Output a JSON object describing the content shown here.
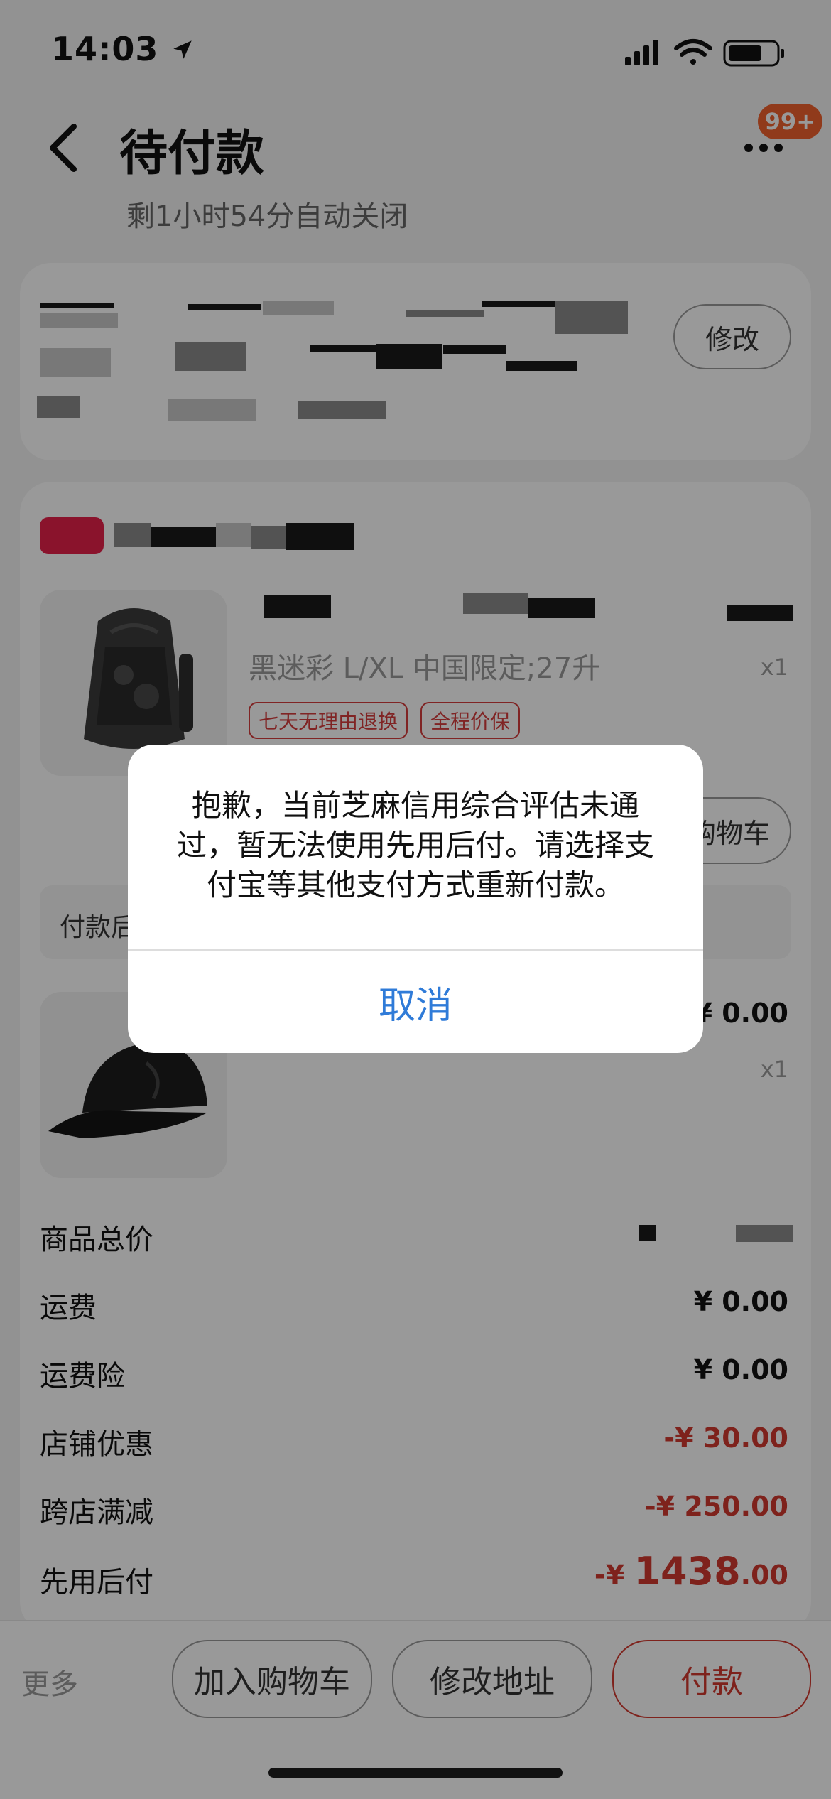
{
  "status_bar": {
    "time": "14:03"
  },
  "header": {
    "title": "待付款",
    "countdown": "剩1小时54分自动关闭",
    "badge": "99+"
  },
  "address": {
    "modify_label": "修改"
  },
  "items": [
    {
      "spec": "黑迷彩 L/XL 中国限定;27升",
      "qty": "x1",
      "tags": [
        "七天无理由退换",
        "全程价保"
      ],
      "add_cart_label": "购物车",
      "after_pay_label": "付款后"
    },
    {
      "price": "¥ 0.00",
      "qty": "x1"
    }
  ],
  "summary": [
    {
      "label": "商品总价",
      "value": ""
    },
    {
      "label": "运费",
      "value": "¥ 0.00"
    },
    {
      "label": "运费险",
      "value": "¥ 0.00"
    },
    {
      "label": "店铺优惠",
      "value": "-¥ 30.00"
    },
    {
      "label": "跨店满减",
      "value": "-¥ 250.00"
    },
    {
      "label": "先用后付",
      "value_prefix": "-¥ ",
      "value_big": "1438",
      "value_small": ".00"
    }
  ],
  "bottom_bar": {
    "more": "更多",
    "add_cart": "加入购物车",
    "change_address": "修改地址",
    "pay": "付款"
  },
  "dialog": {
    "message": "抱歉，当前芝麻信用综合评估未通过，暂无法使用先用后付。请选择支付宝等其他支付方式重新付款。",
    "cancel": "取消"
  },
  "colors": {
    "accent_red": "#d23a2f",
    "link_blue": "#2f7bd8",
    "badge_orange": "#f0622d"
  }
}
